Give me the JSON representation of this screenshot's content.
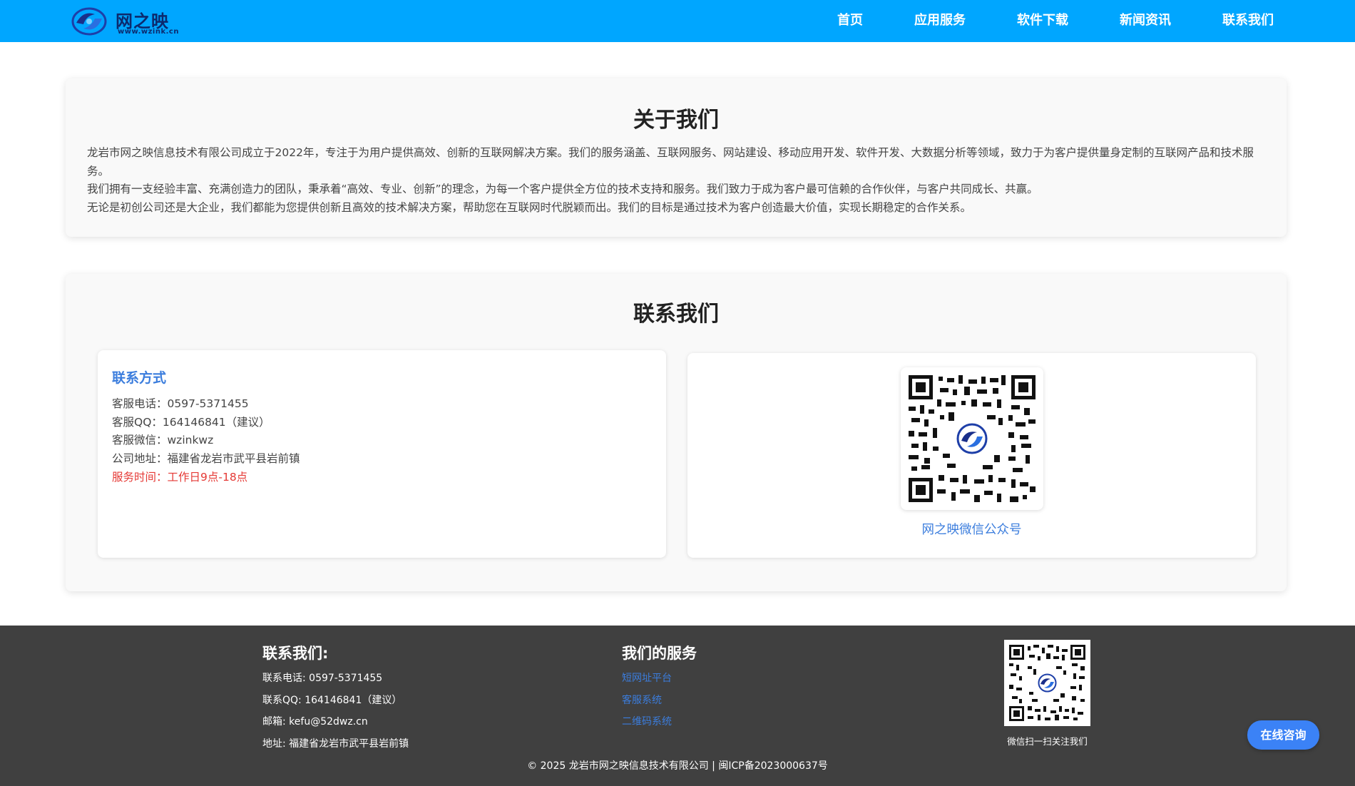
{
  "header": {
    "logo_text": "网之映",
    "logo_sub": "www.wzink.cn",
    "nav": [
      "首页",
      "应用服务",
      "软件下载",
      "新闻资讯",
      "联系我们"
    ]
  },
  "about": {
    "title": "关于我们",
    "paragraphs": [
      "龙岩市网之映信息技术有限公司成立于2022年，专注于为用户提供高效、创新的互联网解决方案。我们的服务涵盖、互联网服务、网站建设、移动应用开发、软件开发、大数据分析等领域，致力于为客户提供量身定制的互联网产品和技术服务。",
      "我们拥有一支经验丰富、充满创造力的团队，秉承着“高效、专业、创新”的理念，为每一个客户提供全方位的技术支持和服务。我们致力于成为客户最可信赖的合作伙伴，与客户共同成长、共赢。",
      "无论是初创公司还是大企业，我们都能为您提供创新且高效的技术解决方案，帮助您在互联网时代脱颖而出。我们的目标是通过技术为客户创造最大价值，实现长期稳定的合作关系。"
    ]
  },
  "contact": {
    "title": "联系我们",
    "box_title": "联系方式",
    "phone": "客服电话：0597-5371455",
    "qq": "客服QQ：164146841（建议）",
    "wechat": "客服微信：wzinkwz",
    "address": "公司地址：福建省龙岩市武平县岩前镇",
    "hours": "服务时间：工作日9点-18点",
    "qr_caption": "网之映微信公众号"
  },
  "footer": {
    "contact_title": "联系我们:",
    "phone": "联系电话: 0597-5371455",
    "qq": "联系QQ: 164146841（建议）",
    "email": "邮箱: kefu@52dwz.cn",
    "address": "地址: 福建省龙岩市武平县岩前镇",
    "services_title": "我们的服务",
    "services": [
      "短网址平台",
      "客服系统",
      "二维码系统"
    ],
    "qr_caption": "微信扫一扫关注我们",
    "copyright": "© 2025 龙岩市网之映信息技术有限公司 | 闽ICP备2023000637号"
  },
  "consult_button": "在线咨询",
  "colors": {
    "header_bg": "#00a6ff",
    "accent": "#3b7ddd",
    "footer_bg": "#404040",
    "warning": "#e53935",
    "button": "#3b82f6"
  }
}
